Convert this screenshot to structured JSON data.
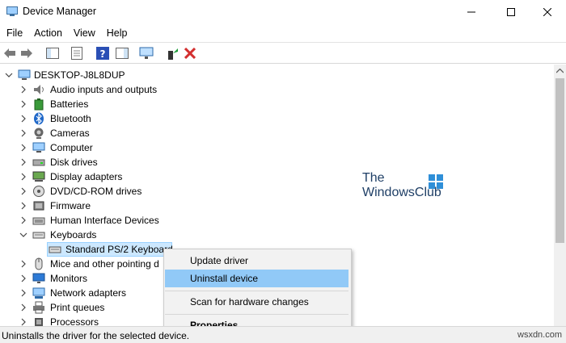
{
  "window": {
    "title": "Device Manager"
  },
  "menubar": [
    "File",
    "Action",
    "View",
    "Help"
  ],
  "toolbar": {
    "icons": [
      "back-arrow-icon",
      "forward-arrow-icon",
      "show-hide-console-tree-icon",
      "properties-sheet-icon",
      "help-icon",
      "action-pane-icon",
      "monitor-icon",
      "update-driver-icon",
      "uninstall-device-icon"
    ]
  },
  "tree": {
    "root": "DESKTOP-J8L8DUP",
    "items": [
      {
        "label": "Audio inputs and outputs",
        "icon": "speaker-icon"
      },
      {
        "label": "Batteries",
        "icon": "battery-icon"
      },
      {
        "label": "Bluetooth",
        "icon": "bluetooth-icon"
      },
      {
        "label": "Cameras",
        "icon": "camera-icon"
      },
      {
        "label": "Computer",
        "icon": "computer-icon"
      },
      {
        "label": "Disk drives",
        "icon": "disk-drive-icon"
      },
      {
        "label": "Display adapters",
        "icon": "display-adapter-icon"
      },
      {
        "label": "DVD/CD-ROM drives",
        "icon": "dvd-icon"
      },
      {
        "label": "Firmware",
        "icon": "firmware-icon"
      },
      {
        "label": "Human Interface Devices",
        "icon": "hid-icon"
      },
      {
        "label": "Keyboards",
        "icon": "keyboard-icon",
        "expanded": true
      },
      {
        "label": "Mice and other pointing d",
        "icon": "mouse-icon"
      },
      {
        "label": "Monitors",
        "icon": "monitor-icon"
      },
      {
        "label": "Network adapters",
        "icon": "network-adapter-icon"
      },
      {
        "label": "Print queues",
        "icon": "printer-icon"
      },
      {
        "label": "Processors",
        "icon": "processor-icon"
      }
    ],
    "child": {
      "label": "Standard PS/2 Keyboard",
      "icon": "keyboard-icon"
    }
  },
  "context_menu": {
    "items": [
      "Update driver",
      "Uninstall device",
      "Scan for hardware changes",
      "Properties"
    ]
  },
  "statusbar": {
    "text": "Uninstalls the driver for the selected device.",
    "site": "wsxdn.com"
  },
  "watermark": {
    "line1": "The",
    "line2": "WindowsClub"
  },
  "colors": {
    "selection": "#cce8ff",
    "menu_highlight": "#91c9f7",
    "delete_red": "#d32f2f"
  }
}
